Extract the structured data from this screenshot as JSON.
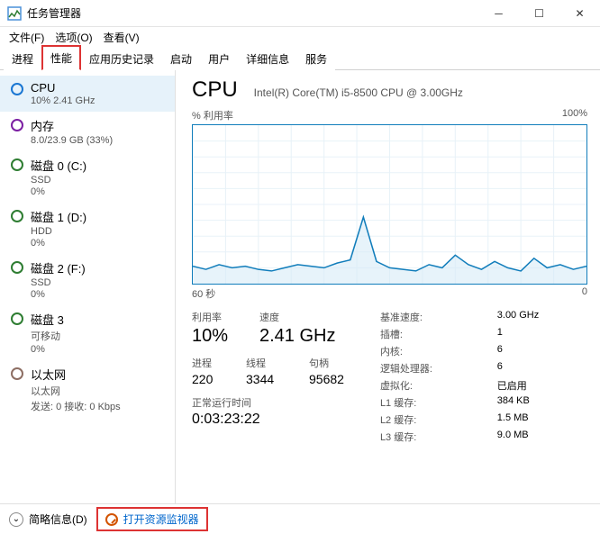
{
  "window": {
    "title": "任务管理器"
  },
  "menu": {
    "file": "文件(F)",
    "options": "选项(O)",
    "view": "查看(V)"
  },
  "tabs": {
    "processes": "进程",
    "performance": "性能",
    "app_history": "应用历史记录",
    "startup": "启动",
    "users": "用户",
    "details": "详细信息",
    "services": "服务"
  },
  "sidebar": [
    {
      "name": "CPU",
      "sub": "10% 2.41 GHz",
      "ring": "blue",
      "active": true
    },
    {
      "name": "内存",
      "sub": "8.0/23.9 GB (33%)",
      "ring": "purple"
    },
    {
      "name": "磁盘 0 (C:)",
      "sub": "SSD",
      "sub2": "0%",
      "ring": "green"
    },
    {
      "name": "磁盘 1 (D:)",
      "sub": "HDD",
      "sub2": "0%",
      "ring": "green"
    },
    {
      "name": "磁盘 2 (F:)",
      "sub": "SSD",
      "sub2": "0%",
      "ring": "green"
    },
    {
      "name": "磁盘 3",
      "sub": "可移动",
      "sub2": "0%",
      "ring": "green"
    },
    {
      "name": "以太网",
      "sub": "以太网",
      "sub2": "发送: 0 接收: 0 Kbps",
      "ring": "brown"
    }
  ],
  "main": {
    "title": "CPU",
    "model": "Intel(R) Core(TM) i5-8500 CPU @ 3.00GHz",
    "chart_label_top_left": "% 利用率",
    "chart_label_top_right": "100%",
    "chart_label_bot_left": "60 秒",
    "chart_label_bot_right": "0",
    "util_l": "利用率",
    "util_v": "10%",
    "speed_l": "速度",
    "speed_v": "2.41 GHz",
    "proc_l": "进程",
    "proc_v": "220",
    "thread_l": "线程",
    "thread_v": "3344",
    "handle_l": "句柄",
    "handle_v": "95682",
    "uptime_l": "正常运行时间",
    "uptime_v": "0:03:23:22",
    "right": {
      "base_l": "基准速度:",
      "base_v": "3.00 GHz",
      "sockets_l": "插槽:",
      "sockets_v": "1",
      "cores_l": "内核:",
      "cores_v": "6",
      "lproc_l": "逻辑处理器:",
      "lproc_v": "6",
      "virt_l": "虚拟化:",
      "virt_v": "已启用",
      "l1_l": "L1 缓存:",
      "l1_v": "384 KB",
      "l2_l": "L2 缓存:",
      "l2_v": "1.5 MB",
      "l3_l": "L3 缓存:",
      "l3_v": "9.0 MB"
    }
  },
  "footer": {
    "collapse": "简略信息(D)",
    "resmon": "打开资源监视器"
  },
  "chart_data": {
    "type": "line",
    "title": "% 利用率",
    "xlabel": "60 秒",
    "ylabel": "",
    "ylim": [
      0,
      100
    ],
    "x_seconds_ago": [
      60,
      58,
      56,
      54,
      52,
      50,
      48,
      46,
      44,
      42,
      40,
      38,
      36,
      34,
      32,
      30,
      28,
      26,
      24,
      22,
      20,
      18,
      16,
      14,
      12,
      10,
      8,
      6,
      4,
      2,
      0
    ],
    "values": [
      11,
      9,
      12,
      10,
      11,
      9,
      8,
      10,
      12,
      11,
      10,
      13,
      15,
      42,
      14,
      10,
      9,
      8,
      12,
      10,
      18,
      12,
      9,
      14,
      10,
      8,
      16,
      10,
      12,
      9,
      11
    ]
  }
}
